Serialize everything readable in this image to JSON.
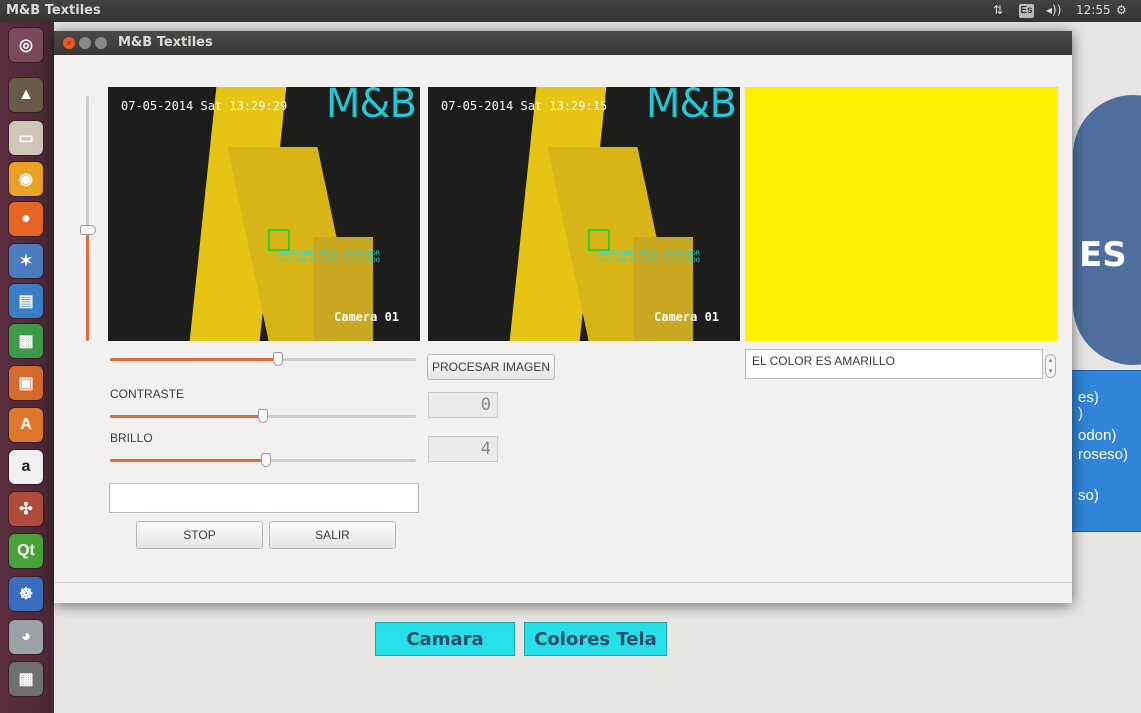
{
  "desktop": {
    "panel_title": "M&B Textiles",
    "panel_clock": "12:55",
    "keyboard_indicator": "Es"
  },
  "window": {
    "title": "M&B Textiles",
    "camera_feeds": [
      {
        "timestamp": "07-05-2014 Sat 13:29:29",
        "brand": "M&B",
        "camera_name": "Camera 01",
        "overlay_text": "VERIFIQUE QUE EL INDICADOR ESTE EN EL LUGAR APROPIADO"
      },
      {
        "timestamp": "07-05-2014 Sat 13:29:15",
        "brand": "M&B",
        "camera_name": "Camera 01",
        "overlay_text": "VERIFIQUE QUE EL INDICADOR ESTE EN EL LUGAR APROPIADO"
      }
    ],
    "color_swatch": "#fff200",
    "process_button": "PROCESAR IMAGEN",
    "result_text": "EL COLOR ES AMARILLO",
    "contrast_label": "CONTRASTE",
    "brightness_label": "BRILLO",
    "lcd_contrast": "0",
    "lcd_brightness": "4",
    "text_input_value": "",
    "stop_button": "STOP",
    "exit_button": "SALIR",
    "slider_levels": {
      "vertical": 0.45,
      "top": 0.55,
      "contrast": 0.5,
      "brightness": 0.51
    }
  },
  "background_app": {
    "logo_text": "ES",
    "list_fragments": [
      "es)",
      ")",
      "odon)",
      "roseso)",
      "so)"
    ],
    "camera_button": "Camara",
    "colors_button": "Colores Tela"
  },
  "colors": {
    "accent": "#e26d3c",
    "cyan_button": "#27dfe8",
    "panel": "#3c3b37"
  }
}
